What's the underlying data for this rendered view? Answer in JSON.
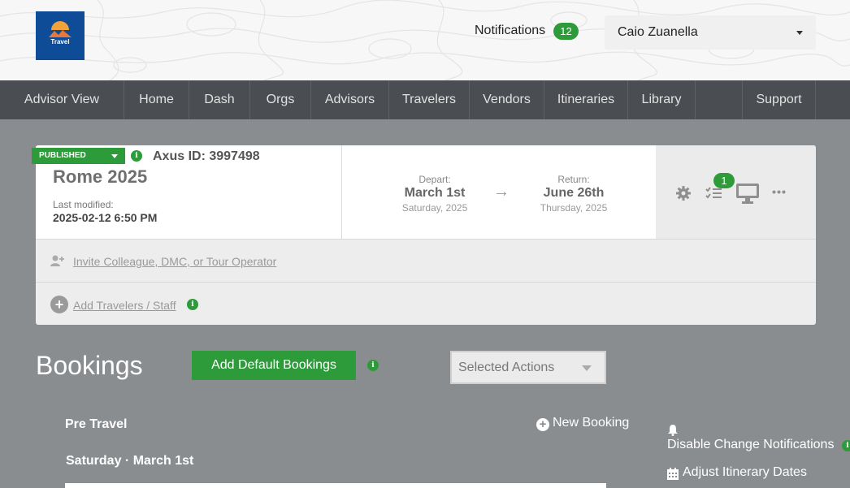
{
  "header": {
    "logo_text": "Travel",
    "notifications_label": "Notifications",
    "notifications_count": "12",
    "user_name": "Caio Zuanella"
  },
  "nav": {
    "items": [
      {
        "label": "Advisor View"
      },
      {
        "label": "Home"
      },
      {
        "label": "Dash"
      },
      {
        "label": "Orgs"
      },
      {
        "label": "Advisors"
      },
      {
        "label": "Travelers"
      },
      {
        "label": "Vendors"
      },
      {
        "label": "Itineraries"
      },
      {
        "label": "Library"
      },
      {
        "label": ""
      },
      {
        "label": "Support"
      }
    ]
  },
  "trip": {
    "status": "PUBLISHED",
    "info_glyph": "i",
    "axus_id": "Axus ID: 3997498",
    "title": "Rome 2025",
    "last_modified_label": "Last modified:",
    "last_modified_value": "2025-02-12 6:50 PM",
    "depart_label": "Depart:",
    "depart_date": "March 1st",
    "depart_day": "Saturday, 2025",
    "arrow": "→",
    "return_label": "Return:",
    "return_date": "June 26th",
    "return_day": "Thursday, 2025",
    "checklist_count": "1",
    "invite_link": "Invite Colleague, DMC, or Tour Operator",
    "add_travelers_link": "Add Travelers / Staff"
  },
  "bookings": {
    "title": "Bookings",
    "add_default_button": "Add Default Bookings",
    "selected_actions": "Selected Actions",
    "pre_travel_label": "Pre Travel",
    "new_booking": "New Booking",
    "day_label": "Saturday · March 1st",
    "disable_notifications": "Disable Change Notifications",
    "adjust_dates": "Adjust Itinerary Dates"
  },
  "colors": {
    "accent_green": "#2e9b3a",
    "nav_bg": "#4a4d51",
    "page_bg": "#8a8d90",
    "logo_bg": "#0f4c97"
  }
}
